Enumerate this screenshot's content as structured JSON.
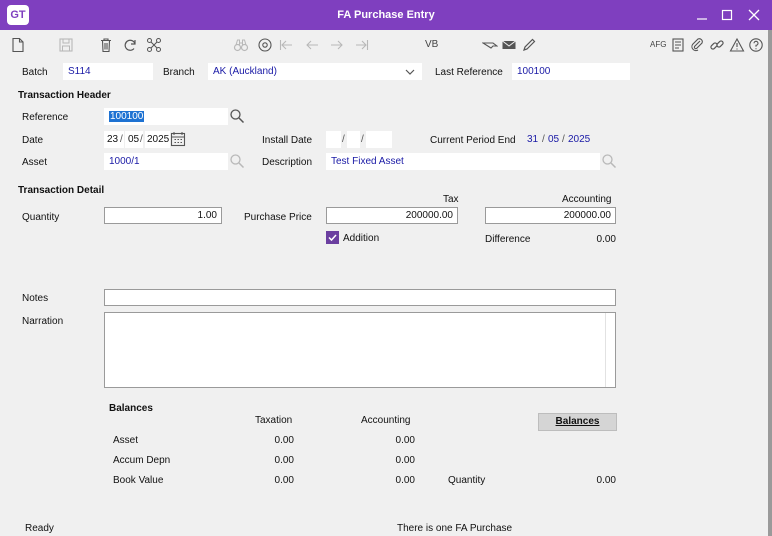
{
  "window": {
    "logo": "GT",
    "title": "FA Purchase Entry",
    "minimize_glyph": "—",
    "maximize_glyph": "☐",
    "close_glyph": "✕"
  },
  "toolbar": {
    "vb_label": "VB",
    "afg_label": "AFG",
    "left_icons": [
      "new-document-icon",
      "save-icon",
      "delete-icon",
      "refresh-icon",
      "connections-icon",
      "binoculars-icon",
      "at-sign-icon",
      "first-record-icon",
      "previous-record-icon",
      "next-record-icon",
      "last-record-icon"
    ],
    "right_icons": [
      "audit-note-icon",
      "attachment-icon",
      "link-icon",
      "warning-icon",
      "help-icon"
    ],
    "mid_icons": [
      "pointer-icon",
      "mail-icon",
      "pen-icon"
    ]
  },
  "header": {
    "batch_label": "Batch",
    "batch_value": "S114",
    "branch_label": "Branch",
    "branch_value": "AK (Auckland)",
    "last_reference_label": "Last Reference",
    "last_reference_value": "100100"
  },
  "transaction_header": {
    "section_label": "Transaction Header",
    "reference_label": "Reference",
    "reference_value": "100100",
    "date_label": "Date",
    "date_day": "23",
    "date_month": "05",
    "date_year": "2025",
    "date_sep": "/",
    "install_date_label": "Install Date",
    "install_date_day": "",
    "install_date_month": "",
    "install_date_year": "",
    "current_period_end_label": "Current Period End",
    "current_period_day": "31",
    "current_period_month": "05",
    "current_period_year": "2025",
    "asset_label": "Asset",
    "asset_value": "1000/1",
    "description_label": "Description",
    "description_value": "Test Fixed Asset"
  },
  "transaction_detail": {
    "section_label": "Transaction Detail",
    "tax_header": "Tax",
    "accounting_header": "Accounting",
    "quantity_label": "Quantity",
    "quantity_value": "1.00",
    "purchase_price_label": "Purchase Price",
    "purchase_price_tax": "200000.00",
    "purchase_price_accounting": "200000.00",
    "addition_label": "Addition",
    "addition_checked": true,
    "difference_label": "Difference",
    "difference_value": "0.00"
  },
  "notes": {
    "notes_label": "Notes",
    "notes_value": "",
    "narration_label": "Narration",
    "narration_value": ""
  },
  "balances": {
    "section_label": "Balances",
    "taxation_header": "Taxation",
    "accounting_header": "Accounting",
    "button_label": "Balances",
    "rows": [
      {
        "label": "Asset",
        "taxation": "0.00",
        "accounting": "0.00"
      },
      {
        "label": "Accum Depn",
        "taxation": "0.00",
        "accounting": "0.00"
      },
      {
        "label": "Book Value",
        "taxation": "0.00",
        "accounting": "0.00"
      }
    ],
    "quantity_label": "Quantity",
    "quantity_value": "0.00"
  },
  "status": {
    "left": "Ready",
    "center": "There is one FA Purchase"
  },
  "colors": {
    "titlebar": "#7f3fbf",
    "field_text": "#1a1aa6",
    "selection": "#1e72d2",
    "checkbox": "#6b3fa0"
  }
}
